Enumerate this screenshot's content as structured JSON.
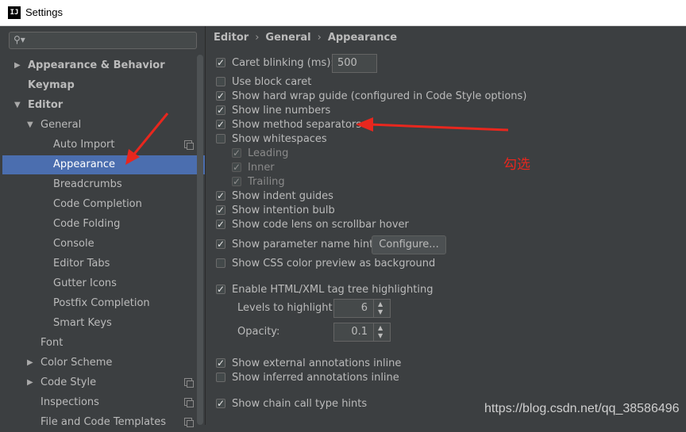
{
  "window": {
    "title": "Settings",
    "app_icon": "IJ"
  },
  "search": {
    "placeholder": ""
  },
  "sidebar": {
    "items": [
      {
        "label": "Appearance & Behavior",
        "bold": true,
        "arrow": "right"
      },
      {
        "label": "Keymap",
        "bold": true
      },
      {
        "label": "Editor",
        "bold": true,
        "arrow": "down"
      },
      {
        "label": "General",
        "arrow": "down"
      },
      {
        "label": "Auto Import",
        "copy": true
      },
      {
        "label": "Appearance",
        "selected": true
      },
      {
        "label": "Breadcrumbs"
      },
      {
        "label": "Code Completion"
      },
      {
        "label": "Code Folding"
      },
      {
        "label": "Console"
      },
      {
        "label": "Editor Tabs"
      },
      {
        "label": "Gutter Icons"
      },
      {
        "label": "Postfix Completion"
      },
      {
        "label": "Smart Keys"
      },
      {
        "label": "Font"
      },
      {
        "label": "Color Scheme",
        "arrow": "right"
      },
      {
        "label": "Code Style",
        "arrow": "right",
        "copy": true
      },
      {
        "label": "Inspections",
        "copy": true
      },
      {
        "label": "File and Code Templates",
        "copy": true
      }
    ]
  },
  "breadcrumb": {
    "part1": "Editor",
    "part2": "General",
    "part3": "Appearance",
    "sep": "›"
  },
  "options": {
    "caret_blinking": {
      "label": "Caret blinking (ms):",
      "checked": true,
      "value": "500"
    },
    "block_caret": {
      "label": "Use block caret",
      "checked": false
    },
    "hard_wrap": {
      "label": "Show hard wrap guide (configured in Code Style options)",
      "checked": true
    },
    "line_numbers": {
      "label": "Show line numbers",
      "checked": true
    },
    "method_separators": {
      "label": "Show method separators",
      "checked": true
    },
    "whitespaces": {
      "label": "Show whitespaces",
      "checked": false
    },
    "leading": {
      "label": "Leading",
      "checked": true
    },
    "inner": {
      "label": "Inner",
      "checked": true
    },
    "trailing": {
      "label": "Trailing",
      "checked": true
    },
    "indent_guides": {
      "label": "Show indent guides",
      "checked": true
    },
    "intention_bulb": {
      "label": "Show intention bulb",
      "checked": true
    },
    "code_lens": {
      "label": "Show code lens on scrollbar hover",
      "checked": true
    },
    "param_hints": {
      "label": "Show parameter name hints",
      "checked": true,
      "button": "Configure..."
    },
    "css_preview": {
      "label": "Show CSS color preview as background",
      "checked": false
    },
    "tag_tree": {
      "label": "Enable HTML/XML tag tree highlighting",
      "checked": true
    },
    "levels": {
      "label": "Levels to highlight:",
      "value": "6"
    },
    "opacity": {
      "label": "Opacity:",
      "value": "0.1"
    },
    "external_annotations": {
      "label": "Show external annotations inline",
      "checked": true
    },
    "inferred_annotations": {
      "label": "Show inferred annotations inline",
      "checked": false
    },
    "chain_call": {
      "label": "Show chain call type hints",
      "checked": true
    }
  },
  "annotation": {
    "note": "勾选",
    "color": "#e8271e"
  },
  "watermark": "https://blog.csdn.net/qq_38586496",
  "colors": {
    "selection": "#4b6eaf",
    "background": "#3c3f41",
    "text": "#bbbbbb"
  }
}
